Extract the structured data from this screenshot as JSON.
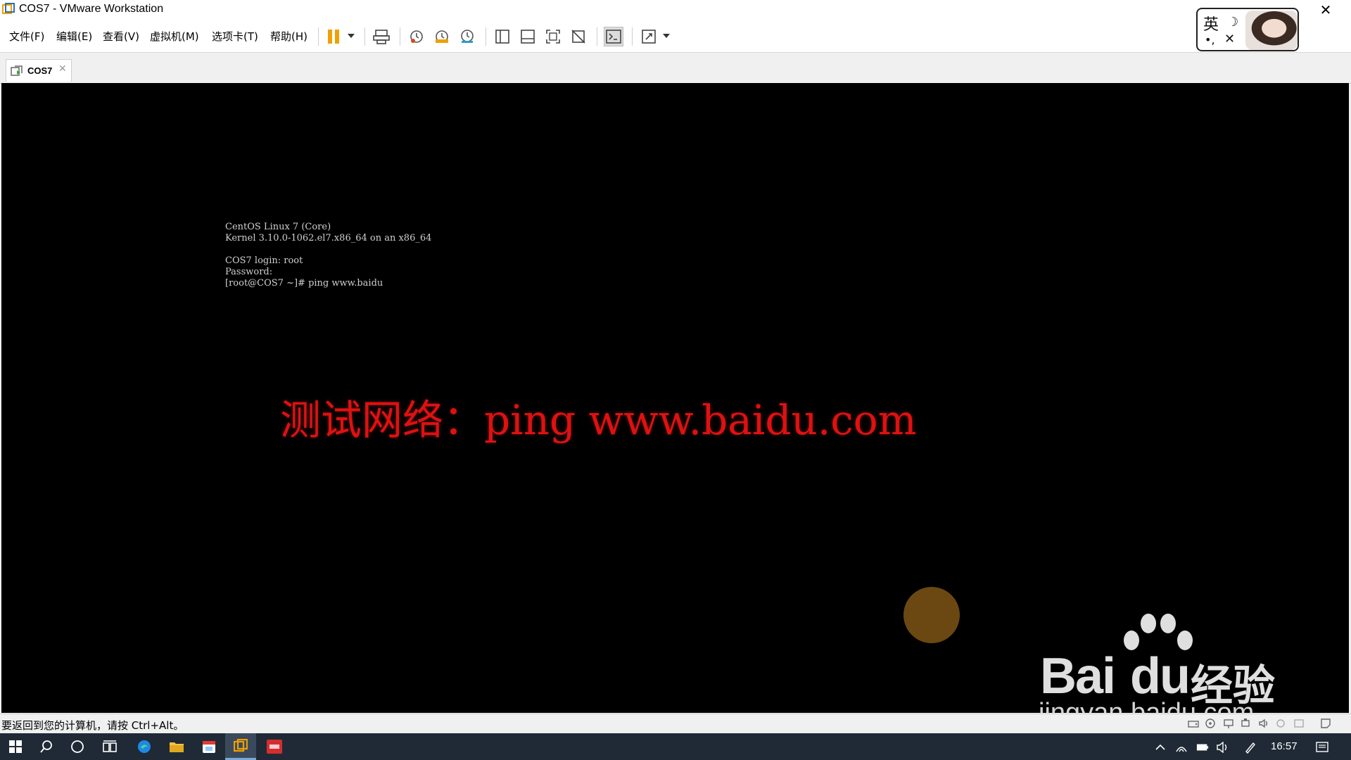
{
  "window": {
    "title": "COS7 - VMware Workstation",
    "close_glyph": "✕"
  },
  "menu": {
    "items": [
      {
        "label": "文件(F)"
      },
      {
        "label": "编辑(E)"
      },
      {
        "label": "查看(V)"
      },
      {
        "label": "虚拟机(M)"
      },
      {
        "label": "选项卡(T)"
      },
      {
        "label": "帮助(H)"
      }
    ]
  },
  "toolbar": {
    "icons": [
      "pause-icon",
      "send-ctrl-alt-del-icon",
      "snapshot-icon",
      "revert-snapshot-icon",
      "snapshot-manager-icon",
      "library-view-icon",
      "thumbnail-bar-icon",
      "full-screen-icon",
      "unity-icon",
      "console-view-icon",
      "stretch-guest-icon"
    ],
    "accent_color": "#f0a000"
  },
  "ime": {
    "language_char": "英",
    "moon_glyph": "☽",
    "punct_glyph": "•,",
    "butterfly_glyph": "✕"
  },
  "tabs": [
    {
      "label": "COS7",
      "close_glyph": "✕",
      "active": true
    }
  ],
  "console": {
    "lines": [
      "CentOS Linux 7 (Core)",
      "Kernel 3.10.0-1062.el7.x86_64 on an x86_64",
      "",
      "COS7 login: root",
      "Password:",
      "[root@COS7 ~]# ping www.baidu"
    ],
    "text_color": "#cfcfcf",
    "background": "#000000"
  },
  "overlay": {
    "caption": "测试网络：ping www.baidu.com",
    "color": "#e01010"
  },
  "watermark": {
    "brand_latin": "Bai",
    "brand_du": "du",
    "brand_cn": "经验",
    "url": "jingyan.baidu.com"
  },
  "statusbar": {
    "hint": "要返回到您的计算机，请按 Ctrl+Alt。"
  },
  "taskbar": {
    "clock": "16:57",
    "pinned": [
      "windows-start-icon",
      "search-icon",
      "cortana-icon",
      "task-view-icon",
      "edge-icon",
      "file-explorer-icon",
      "calendar-app-icon",
      "vmware-icon",
      "red-app-icon"
    ]
  }
}
